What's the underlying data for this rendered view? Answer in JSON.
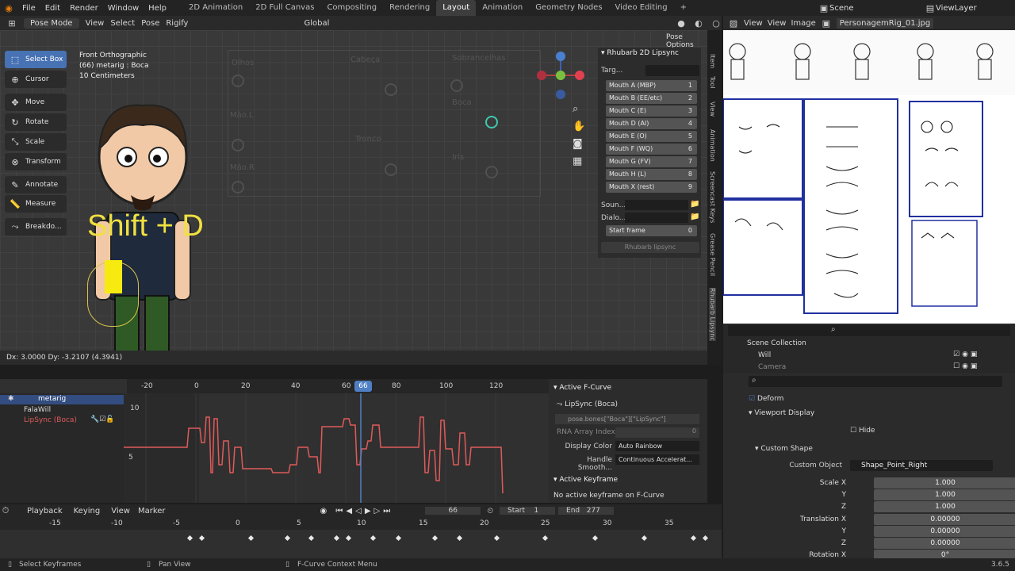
{
  "topbar": {
    "menus": [
      "File",
      "Edit",
      "Render",
      "Window",
      "Help"
    ],
    "workspaces": [
      "2D Animation",
      "2D Full Canvas",
      "Compositing",
      "Rendering",
      "Layout",
      "Animation",
      "Geometry Nodes",
      "Video Editing"
    ],
    "active_workspace": "Layout",
    "scene": "Scene",
    "view_layer": "ViewLayer"
  },
  "viewport_header": {
    "mode": "Pose Mode",
    "menus": [
      "View",
      "Select",
      "Pose",
      "Rigify"
    ],
    "orientation": "Global",
    "pose_options": "Pose Options"
  },
  "viewport": {
    "info_line1": "Front Orthographic",
    "info_line2": "(66) metarig : Boca",
    "info_line3": "10 Centimeters",
    "overlay_text": "Shift + D",
    "rig_labels": [
      "Olhos",
      "Cabeça",
      "Sobrancelhas",
      "Mão.L",
      "Boca",
      "Tronco",
      "Mão.R",
      "Iris"
    ],
    "tools": [
      "Select Box",
      "Cursor",
      "Move",
      "Rotate",
      "Scale",
      "Transform",
      "Annotate",
      "Measure",
      "Breakdo..."
    ],
    "status": "Dx: 3.0000   Dy: -3.2107 (4.3941)"
  },
  "lipsync_panel": {
    "title": "Rhubarb 2D Lipsync",
    "target_label": "Targ...",
    "mouths": [
      {
        "label": "Mouth A (MBP)",
        "num": "1"
      },
      {
        "label": "Mouth B (EE/etc)",
        "num": "2"
      },
      {
        "label": "Mouth C (E)",
        "num": "3"
      },
      {
        "label": "Mouth D (AI)",
        "num": "4"
      },
      {
        "label": "Mouth E (O)",
        "num": "5"
      },
      {
        "label": "Mouth F (WQ)",
        "num": "6"
      },
      {
        "label": "Mouth G (FV)",
        "num": "7"
      },
      {
        "label": "Mouth H (L)",
        "num": "8"
      },
      {
        "label": "Mouth X (rest)",
        "num": "9"
      }
    ],
    "sound_label": "Soun...",
    "dialog_label": "Dialo...",
    "start_frame_label": "Start frame",
    "start_frame_value": "0",
    "run_button": "Rhubarb lipsync"
  },
  "side_tabs": [
    "Item",
    "Tool",
    "View",
    "Animation",
    "Screencast Keys",
    "Grease Pencil",
    "Rhubarb Lipsync"
  ],
  "image_editor": {
    "menus": [
      "View",
      "View",
      "Image"
    ],
    "image_name": "PersonagemRig_01.jpg"
  },
  "outliner": {
    "root": "Scene Collection",
    "items": [
      "Will",
      "Camera"
    ]
  },
  "properties": {
    "deform": "Deform",
    "viewport_display": "Viewport Display",
    "hide": "Hide",
    "custom_shape": "Custom Shape",
    "custom_object_label": "Custom Object",
    "custom_object_value": "Shape_Point_Right",
    "rows": [
      {
        "label": "Scale X",
        "value": "1.000"
      },
      {
        "label": "Y",
        "value": "1.000"
      },
      {
        "label": "Z",
        "value": "1.000"
      },
      {
        "label": "Translation X",
        "value": "0.00000"
      },
      {
        "label": "Y",
        "value": "0.00000"
      },
      {
        "label": "Z",
        "value": "0.00000"
      },
      {
        "label": "Rotation X",
        "value": "0°"
      }
    ],
    "version": "3.6.5"
  },
  "graph_editor": {
    "ruler_ticks": [
      "-20",
      "0",
      "20",
      "40",
      "60",
      "80",
      "100",
      "120"
    ],
    "current_frame": "66",
    "y_labels": [
      "10",
      "5"
    ],
    "channels": [
      "metarig",
      "FalaWill",
      "LipSync (Boca)"
    ]
  },
  "fcurve_panel": {
    "title": "Active F-Curve",
    "curve_name": "LipSync (Boca)",
    "data_path": "pose.bones[\"Boca\"][\"LipSync\"]",
    "rna_index_label": "RNA Array Index",
    "rna_index_value": "0",
    "display_color_label": "Display Color",
    "display_color_value": "Auto Rainbow",
    "handle_label": "Handle Smooth...",
    "handle_value": "Continuous Accelerat...",
    "keyframe_title": "Active Keyframe",
    "keyframe_msg": "No active keyframe on F-Curve"
  },
  "timeline": {
    "menus": [
      "Playback",
      "Keying",
      "View",
      "Marker"
    ],
    "current_frame": "66",
    "start_label": "Start",
    "start_value": "1",
    "end_label": "End",
    "end_value": "277",
    "ticks": [
      "-15",
      "-10",
      "-5",
      "0",
      "5",
      "10",
      "15",
      "20",
      "25",
      "30",
      "35"
    ]
  },
  "statusbar": {
    "left": "Select Keyframes",
    "middle": "Pan View",
    "right": "F-Curve Context Menu"
  },
  "colors": {
    "accent": "#4772b3",
    "curve": "#e05a5a",
    "playhead": "#4f7fc4",
    "overlay_text": "#f0e040"
  }
}
